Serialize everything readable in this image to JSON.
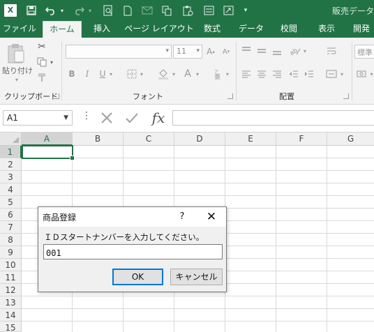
{
  "window": {
    "title": "販売データ"
  },
  "qat": {
    "icons": [
      "excel-logo-icon",
      "save-icon",
      "undo-icon",
      "redo-icon",
      "print-preview-icon",
      "new-icon",
      "email-icon",
      "copy-icon",
      "paste-special-icon",
      "form-icon",
      "calculator-icon",
      "customize-qat-icon"
    ]
  },
  "excel_logo": "X",
  "tabs": [
    {
      "label": "ファイル"
    },
    {
      "label": "ホーム",
      "active": true
    },
    {
      "label": "挿入"
    },
    {
      "label": "ページ レイアウト"
    },
    {
      "label": "数式"
    },
    {
      "label": "データ"
    },
    {
      "label": "校閲"
    },
    {
      "label": "表示"
    },
    {
      "label": "開発"
    }
  ],
  "ribbon": {
    "clipboard": {
      "paste_label": "貼り付け",
      "group_label": "クリップボード"
    },
    "font": {
      "font_size": "11",
      "bold": "B",
      "italic": "I",
      "underline": "U",
      "group_label": "フォント"
    },
    "alignment": {
      "group_label": "配置"
    },
    "number": {
      "format": "標準"
    }
  },
  "formula_bar": {
    "name_box": "A1",
    "dots": "⋮",
    "fx": "fx"
  },
  "grid": {
    "columns": [
      "A",
      "B",
      "C",
      "D",
      "E",
      "F",
      "G"
    ],
    "rows": [
      "1",
      "2",
      "3",
      "4",
      "5",
      "6",
      "7",
      "8",
      "9",
      "10",
      "11",
      "12",
      "13",
      "14",
      "15"
    ],
    "selected_column": "A",
    "selected_row": "1"
  },
  "dialog": {
    "title": "商品登録",
    "help": "?",
    "close": "✕",
    "prompt": "ＩＤスタートナンバーを入力してください。",
    "input_value": "001",
    "ok_label": "OK",
    "cancel_label": "キャンセル"
  }
}
